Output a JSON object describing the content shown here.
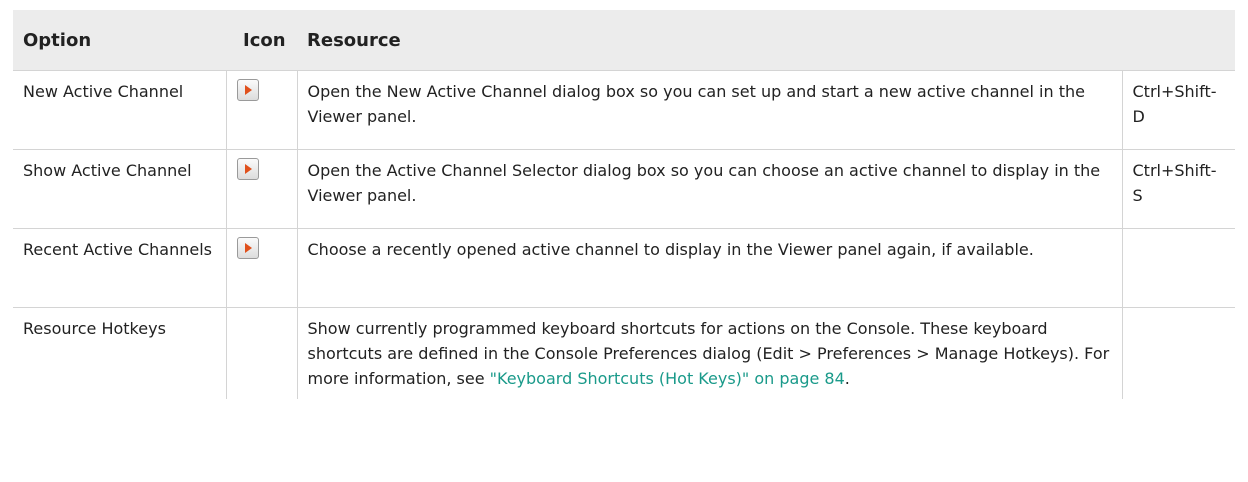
{
  "table": {
    "headers": [
      "Option",
      "Icon",
      "Resource",
      ""
    ],
    "rows": [
      {
        "option": "New Active Channel",
        "icon": "play-arrow-icon",
        "resource": "Open the New Active Channel dialog box so you can set up and start a new active channel in the Viewer panel.",
        "hotkey": "Ctrl+Shift-D"
      },
      {
        "option": "Show Active Channel",
        "icon": "play-arrow-icon",
        "resource": "Open the Active Channel Selector dialog box so you can choose an active channel to display in the Viewer panel.",
        "hotkey": "Ctrl+Shift-S"
      },
      {
        "option": "Recent Active Channels",
        "icon": "play-arrow-icon",
        "resource": "Choose a recently opened active channel to display in the Viewer panel again, if available.",
        "hotkey": ""
      },
      {
        "option": "Resource Hotkeys",
        "icon": "",
        "resource_before_link": "Show currently programmed keyboard shortcuts for actions on the Console. These keyboard shortcuts are defined in the Console Preferences dialog (Edit > Preferences > Manage Hotkeys). For more information, see ",
        "resource_link": "\"Keyboard Shortcuts (Hot Keys)\" on page 84",
        "resource_after_link": ".",
        "hotkey": ""
      }
    ]
  },
  "colors": {
    "header_bg": "#ececec",
    "link": "#1a9a8a",
    "icon_arrow": "#e0501c",
    "grid_line": "#d4d4d4"
  }
}
